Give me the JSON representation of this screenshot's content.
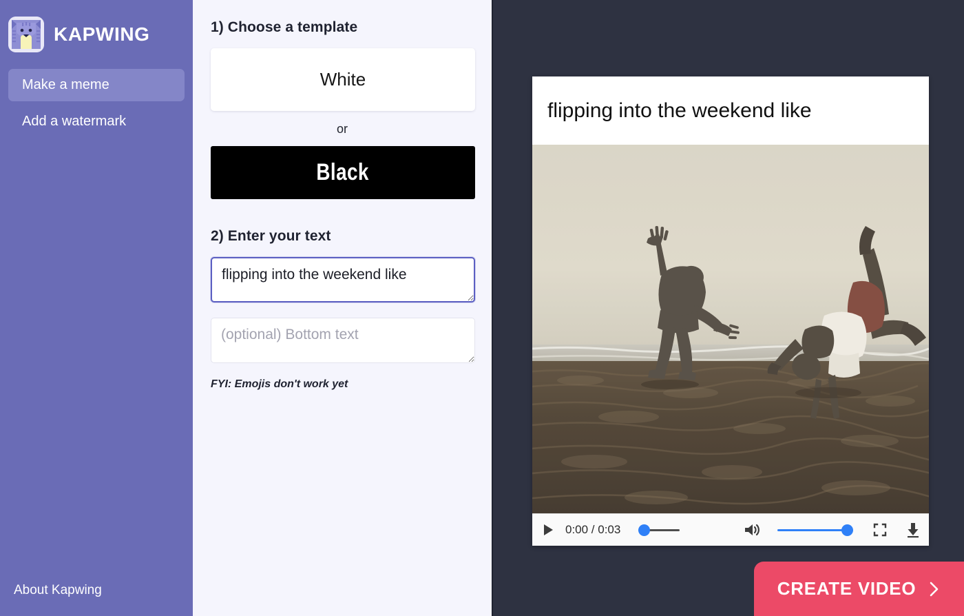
{
  "sidebar": {
    "brand_name": "KAPWING",
    "logo_icon": "cat-logo-icon",
    "items": [
      {
        "label": "Make a meme",
        "active": true
      },
      {
        "label": "Add a watermark",
        "active": false
      }
    ],
    "footer_link": "About Kapwing",
    "bg_color": "#6a6cb6",
    "active_color": "#8486c8"
  },
  "center": {
    "step1_label": "1) Choose a template",
    "template_white_label": "White",
    "or_label": "or",
    "template_black_label": "Black",
    "step2_label": "2) Enter your text",
    "top_text_value": "flipping into the weekend like",
    "bottom_text_value": "",
    "bottom_text_placeholder": "(optional) Bottom text",
    "fyi_note": "FYI: Emojis don't work yet",
    "bg_color": "#f5f5fd"
  },
  "preview": {
    "meme_caption": "flipping into the weekend like",
    "video_alt": "two people silhouetted on a beach, one flipping",
    "controls": {
      "play_icon": "play-icon",
      "time_label": "0:00 / 0:03",
      "current_time": "0:00",
      "duration": "0:03",
      "progress_percent": 0,
      "volume_icon": "volume-up-icon",
      "volume_percent": 100,
      "fullscreen_icon": "fullscreen-icon",
      "download_icon": "download-icon",
      "accent_color": "#2f80f7"
    },
    "bg_color": "#2e3241"
  },
  "cta": {
    "label": "CREATE VIDEO",
    "chevron_icon": "chevron-right-icon",
    "color": "#ec4a67"
  }
}
